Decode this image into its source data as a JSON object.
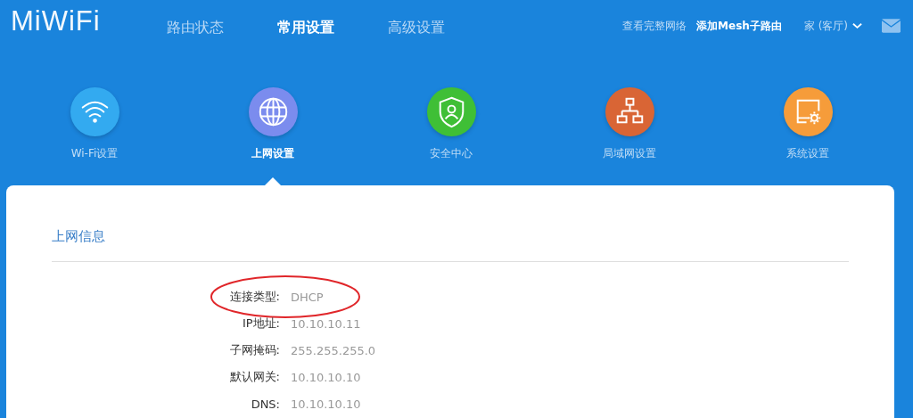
{
  "logo": "MiWiFi",
  "nav": [
    {
      "label": "路由状态",
      "selected": false
    },
    {
      "label": "常用设置",
      "selected": true
    },
    {
      "label": "高级设置",
      "selected": false
    }
  ],
  "top_links": [
    {
      "label": "查看完整网络",
      "kind": "link"
    },
    {
      "label": "添加Mesh子路由",
      "kind": "strong"
    },
    {
      "label": "家 (客厅)",
      "kind": "dropdown"
    }
  ],
  "categories": [
    {
      "label": "Wi-Fi设置",
      "kind": "wifi",
      "color": "#33aaf0",
      "selected": false
    },
    {
      "label": "上网设置",
      "kind": "globe",
      "color": "#7b8cee",
      "selected": true
    },
    {
      "label": "安全中心",
      "kind": "shield",
      "color": "#3fbf36",
      "selected": false
    },
    {
      "label": "局域网设置",
      "kind": "network",
      "color": "#d96535",
      "selected": false
    },
    {
      "label": "系统设置",
      "kind": "system",
      "color": "#f69c3a",
      "selected": false
    }
  ],
  "panel": {
    "title": "上网信息",
    "rows": [
      {
        "label": "连接类型:",
        "value": "DHCP",
        "circled": true
      },
      {
        "label": "IP地址:",
        "value": "10.10.10.11",
        "circled": false
      },
      {
        "label": "子网掩码:",
        "value": "255.255.255.0",
        "circled": false
      },
      {
        "label": "默认网关:",
        "value": "10.10.10.10",
        "circled": false
      },
      {
        "label": "DNS:",
        "value": "10.10.10.10",
        "circled": false
      }
    ]
  }
}
